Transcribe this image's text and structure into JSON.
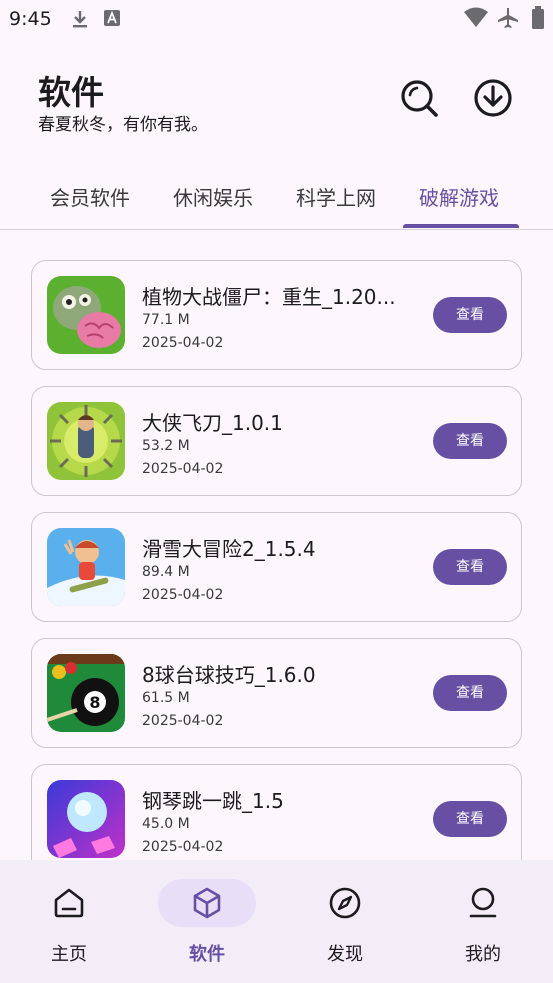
{
  "status_bar": {
    "time": "9:45",
    "icons": [
      "download-icon",
      "text-a-icon",
      "wifi-icon",
      "airplane-icon",
      "battery-icon"
    ]
  },
  "header": {
    "title": "软件",
    "subtitle": "春夏秋冬，有你有我。",
    "icons": [
      "search-icon",
      "download-circle-icon"
    ]
  },
  "tabs": [
    {
      "label": "会员软件",
      "active": false
    },
    {
      "label": "休闲娱乐",
      "active": false
    },
    {
      "label": "科学上网",
      "active": false
    },
    {
      "label": "破解游戏",
      "active": true
    }
  ],
  "apps": [
    {
      "name": "植物大战僵尸：重生_1.20...",
      "size": "77.1 M",
      "date": "2025-04-02",
      "button": "查看",
      "icon": "zombie-game-icon"
    },
    {
      "name": "大侠飞刀_1.0.1",
      "size": "53.2 M",
      "date": "2025-04-02",
      "button": "查看",
      "icon": "knife-hero-game-icon"
    },
    {
      "name": "滑雪大冒险2_1.5.4",
      "size": "89.4 M",
      "date": "2025-04-02",
      "button": "查看",
      "icon": "ski-game-icon"
    },
    {
      "name": "8球台球技巧_1.6.0",
      "size": "61.5 M",
      "date": "2025-04-02",
      "button": "查看",
      "icon": "billiards-game-icon"
    },
    {
      "name": "钢琴跳一跳_1.5",
      "size": "45.0 M",
      "date": "2025-04-02",
      "button": "查看",
      "icon": "piano-ball-game-icon"
    }
  ],
  "bottom_nav": [
    {
      "label": "主页",
      "icon": "home-icon",
      "active": false
    },
    {
      "label": "软件",
      "icon": "cube-icon",
      "active": true
    },
    {
      "label": "发现",
      "icon": "compass-icon",
      "active": false
    },
    {
      "label": "我的",
      "icon": "person-icon",
      "active": false
    }
  ],
  "colors": {
    "accent": "#6750a4",
    "background": "#fdf7fd",
    "nav_bg": "#f3edf7",
    "pill": "#e8def8"
  }
}
